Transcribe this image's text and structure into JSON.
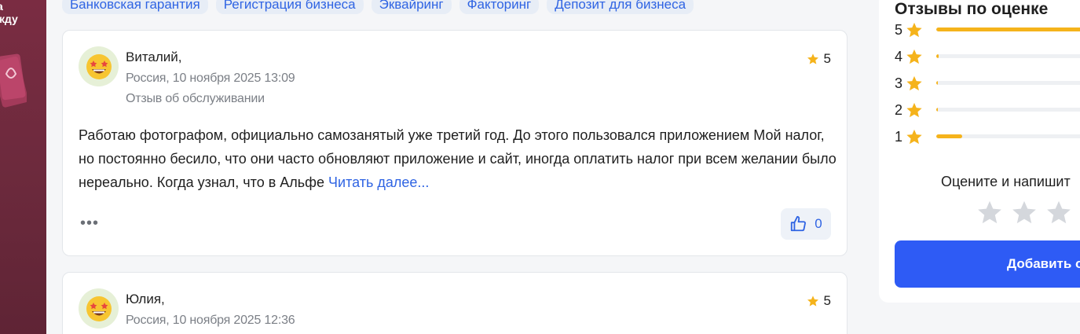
{
  "colors": {
    "accent": "#2f64e3",
    "star": "#f5b31b",
    "button": "#2e5bf5"
  },
  "promo": {
    "text": "а\nжду"
  },
  "tags": [
    "Банковская гарантия",
    "Регистрация бизнеса",
    "Эквайринг",
    "Факторинг",
    "Депозит для бизнеса"
  ],
  "reviews": [
    {
      "name": "Виталий,",
      "location_date": "Россия, 10 ноября 2025 13:09",
      "type": "Отзыв об обслуживании",
      "rating": "5",
      "text": "Работаю фотографом, официально самозанятый уже третий год. До этого пользовался приложением Мой налог, но постоянно бесило, что они часто обновляют приложение и сайт, иногда оплатить налог при всем желании было нереально. Когда узнал, что в Альфе",
      "read_more": "Читать далее...",
      "more": "•••",
      "likes": "0"
    },
    {
      "name": "Юлия,",
      "location_date": "Россия, 10 ноября 2025 12:36",
      "rating": "5"
    }
  ],
  "sidebar": {
    "title": "Отзывы по оценке",
    "distribution": [
      {
        "label": "5",
        "fraction": 0.95
      },
      {
        "label": "4",
        "fraction": 0.015
      },
      {
        "label": "3",
        "fraction": 0.005
      },
      {
        "label": "2",
        "fraction": 0.01
      },
      {
        "label": "1",
        "fraction": 0.15
      }
    ],
    "rate_cta": "Оцените и напишит",
    "add_button": "Добавить о"
  }
}
